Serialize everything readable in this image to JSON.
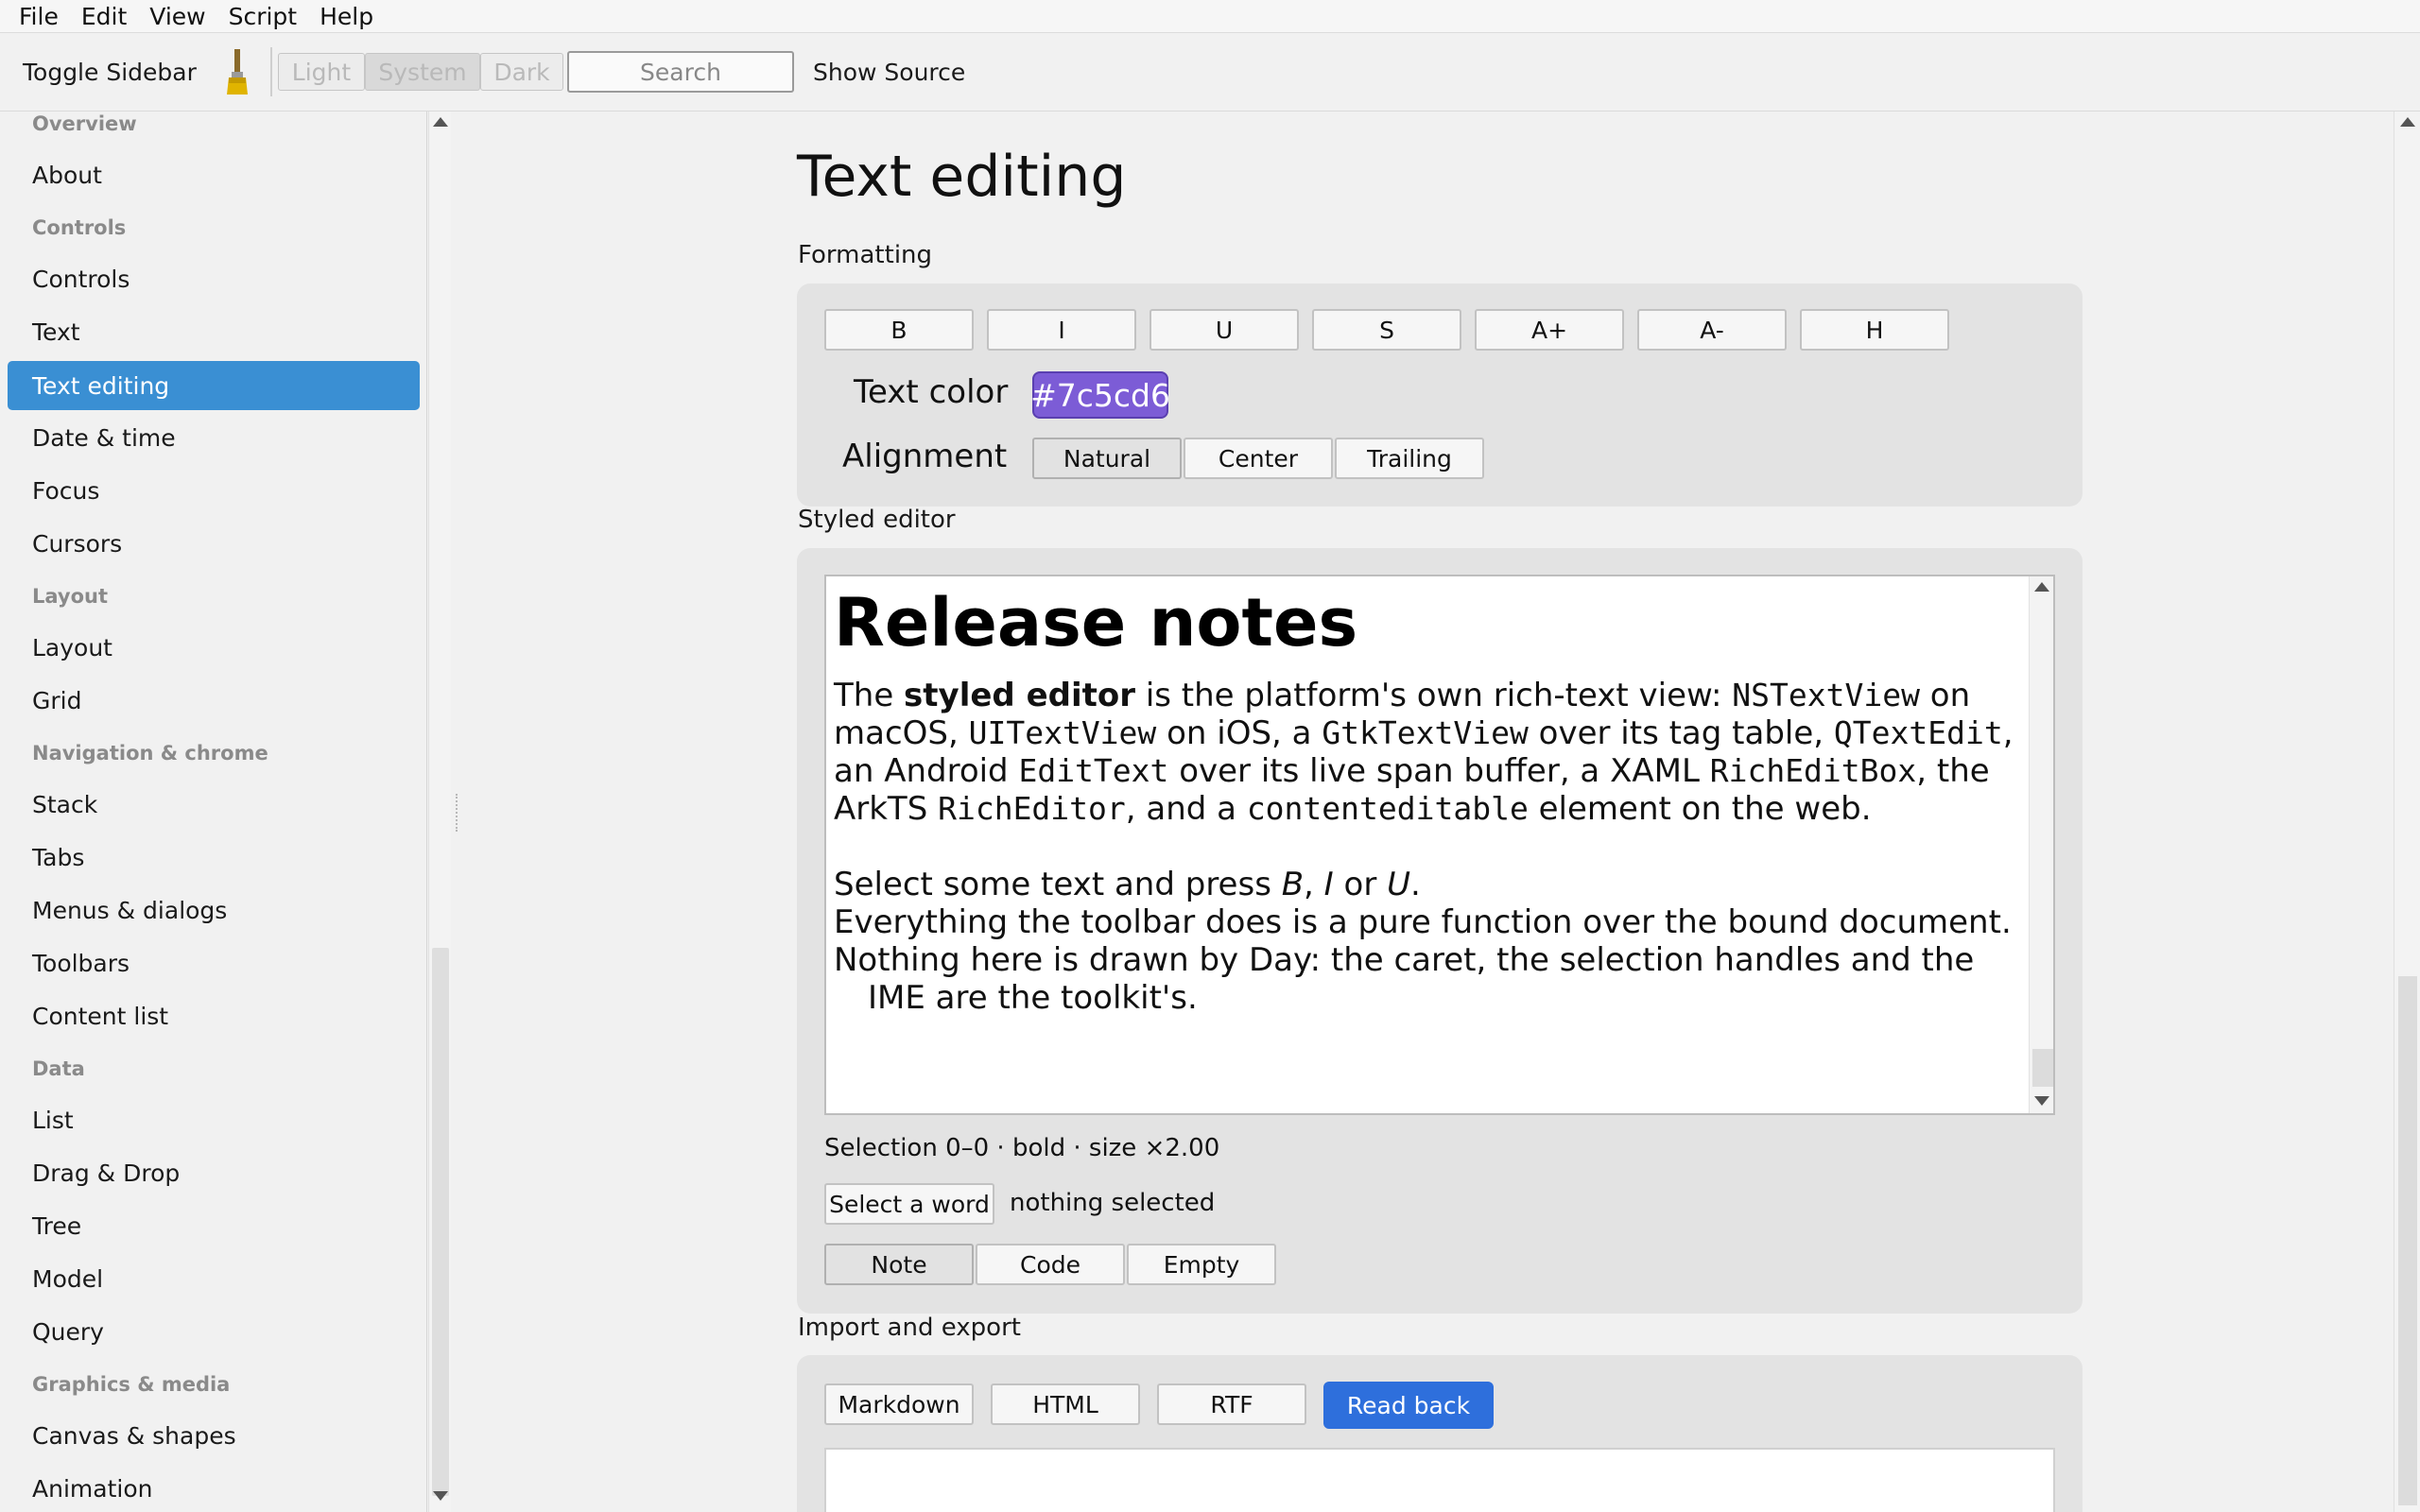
{
  "menu": [
    "File",
    "Edit",
    "View",
    "Script",
    "Help"
  ],
  "toolbar": {
    "toggle_sidebar": "Toggle Sidebar",
    "brush_icon": "paintbrush-icon",
    "theme": [
      "Light",
      "System",
      "Dark"
    ],
    "theme_selected": "System",
    "search_placeholder": "Search",
    "show_source": "Show Source"
  },
  "sidebar": {
    "sections": {
      "overview": "Overview",
      "controls": "Controls",
      "layout": "Layout",
      "navigation": "Navigation & chrome",
      "data": "Data",
      "graphics": "Graphics & media"
    },
    "items": {
      "about": "About",
      "controls": "Controls",
      "text": "Text",
      "text_editing": "Text editing",
      "date_time": "Date & time",
      "focus": "Focus",
      "cursors": "Cursors",
      "layout": "Layout",
      "grid": "Grid",
      "stack": "Stack",
      "tabs": "Tabs",
      "menus_dialogs": "Menus & dialogs",
      "toolbars": "Toolbars",
      "content_list": "Content list",
      "list": "List",
      "drag_drop": "Drag & Drop",
      "tree": "Tree",
      "model": "Model",
      "query": "Query",
      "canvas_shapes": "Canvas & shapes",
      "animation": "Animation"
    },
    "selected": "Text editing"
  },
  "main": {
    "title": "Text editing",
    "formatting": {
      "label": "Formatting",
      "buttons": [
        "B",
        "I",
        "U",
        "S",
        "A+",
        "A-",
        "H"
      ],
      "text_color_label": "Text color",
      "text_color_value": "#7c5cd6",
      "alignment_label": "Alignment",
      "alignment_options": [
        "Natural",
        "Center",
        "Trailing"
      ],
      "alignment_selected": "Natural"
    },
    "styled_editor": {
      "label": "Styled editor",
      "heading": "Release notes",
      "p1_a": "The ",
      "p1_bold": "styled editor",
      "p1_b": " is the platform's own rich-text view: ",
      "c1": "NSTextView",
      "p1_c": " on macOS, ",
      "c2": "UITextView",
      "p1_d": " on iOS, a ",
      "c3": "GtkTextView",
      "p1_e": " over its tag table, ",
      "c4": "QTextEdit",
      "p1_f": ", an Android ",
      "c5": "EditText",
      "p1_g": " over its live span buffer, a XAML ",
      "c6": "RichEditBox",
      "p1_h": ", the ArkTS ",
      "c7": "RichEditor",
      "p1_i": ", and a ",
      "c8": "contenteditable",
      "p1_j": " element on the web.",
      "p2_a": "Select some text and press ",
      "p2_b": "B",
      "p2_c": ", ",
      "p2_i": "I",
      "p2_d": " or ",
      "p2_u": "U",
      "p2_e": ".",
      "p3": "Everything the toolbar does is a pure function over the bound document.",
      "p4": "Nothing here is drawn by Day: the caret, the selection handles and the IME are the toolkit's.",
      "selection_status": "Selection 0–0 · bold · size ×2.00",
      "select_word_button": "Select a word",
      "selected_text_status": "nothing selected",
      "doc_options": [
        "Note",
        "Code",
        "Empty"
      ],
      "doc_selected": "Note"
    },
    "import_export": {
      "label": "Import and export",
      "buttons": [
        "Markdown",
        "HTML",
        "RTF"
      ],
      "read_back": "Read back"
    }
  }
}
